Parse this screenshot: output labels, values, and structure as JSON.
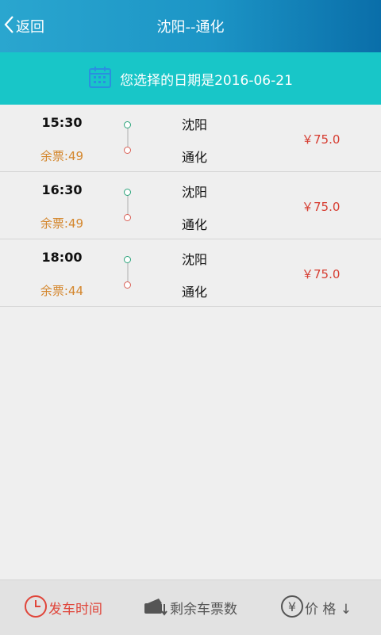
{
  "header": {
    "back_label": "返回",
    "title": "沈阳--通化"
  },
  "date_bar": {
    "text": "您选择的日期是2016-06-21"
  },
  "trips": [
    {
      "time": "15:30",
      "seats": "余票:49",
      "from": "沈阳",
      "to": "通化",
      "price": "￥75.0"
    },
    {
      "time": "16:30",
      "seats": "余票:49",
      "from": "沈阳",
      "to": "通化",
      "price": "￥75.0"
    },
    {
      "time": "18:00",
      "seats": "余票:44",
      "from": "沈阳",
      "to": "通化",
      "price": "￥75.0"
    }
  ],
  "bottom_tabs": {
    "departure": "发车时间",
    "seats": "剩余车票数",
    "price": "价 格 ↓"
  },
  "icons": {
    "back": "chevron-left-icon",
    "date": "calendar-icon",
    "departure": "clock-icon",
    "seats": "ticket-icon",
    "price": "yen-icon"
  },
  "colors": {
    "header": "#1c95c6",
    "date_bar": "#18c6c8",
    "price": "#d63b2f",
    "seats": "#d4862c",
    "active_tab": "#e0453a"
  }
}
